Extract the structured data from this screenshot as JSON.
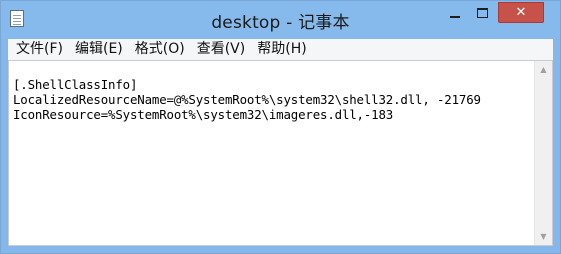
{
  "window": {
    "title": "desktop - 记事本",
    "icons": {
      "app": "notepad-icon",
      "minimize": "minimize-icon",
      "maximize": "maximize-icon",
      "close": "close-icon"
    },
    "close_glyph": "✕"
  },
  "menu": {
    "items": [
      {
        "label": "文件(F)"
      },
      {
        "label": "编辑(E)"
      },
      {
        "label": "格式(O)"
      },
      {
        "label": "查看(V)"
      },
      {
        "label": "帮助(H)"
      }
    ]
  },
  "document": {
    "lines": [
      "[.ShellClassInfo]",
      "LocalizedResourceName=@%SystemRoot%\\system32\\shell32.dll, -21769",
      "IconResource=%SystemRoot%\\system32\\imageres.dll,-183"
    ]
  },
  "scrollbar": {
    "up_glyph": "▲",
    "down_glyph": "▼"
  },
  "colors": {
    "titlebar": "#86b9ec",
    "close_button": "#c7524a",
    "menubar": "#f5f6f7"
  }
}
